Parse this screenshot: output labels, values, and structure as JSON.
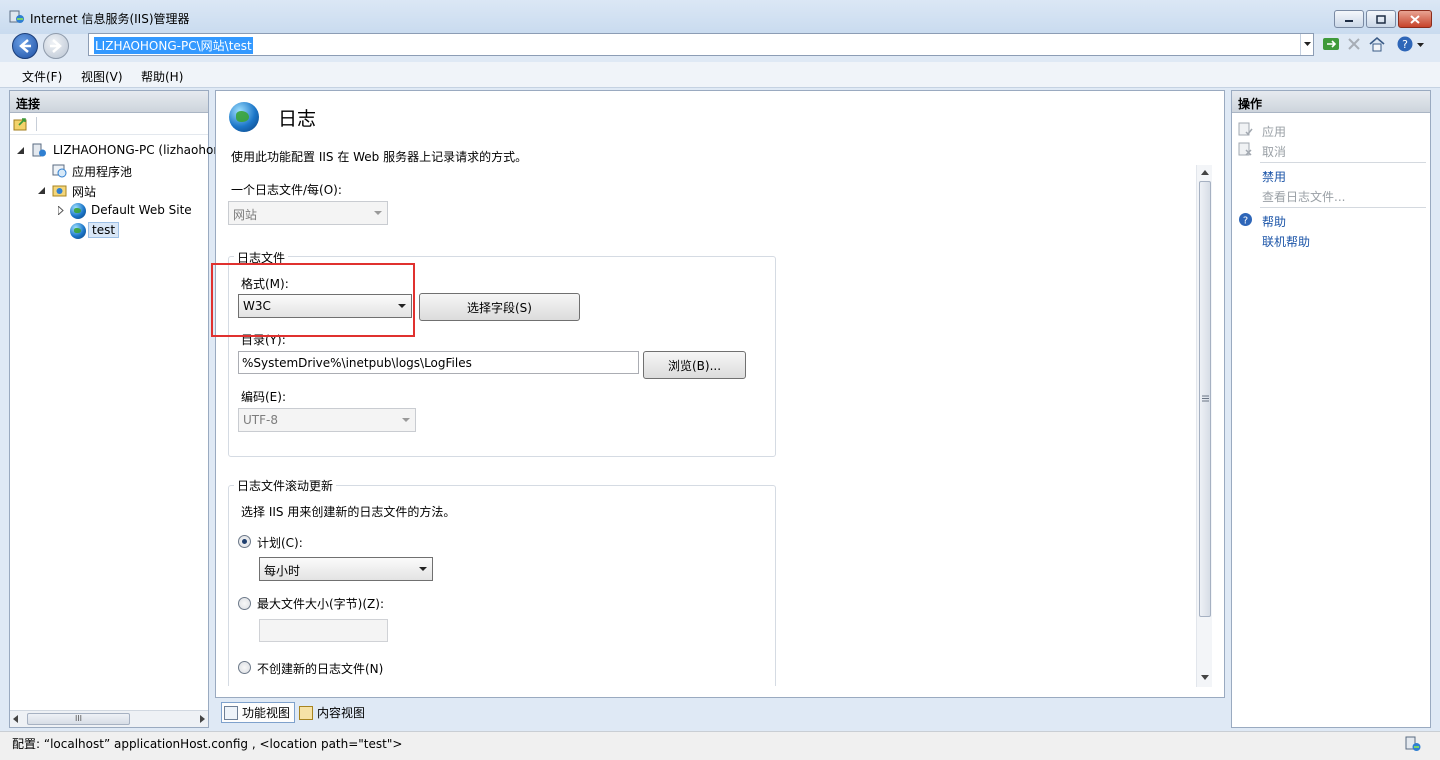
{
  "window": {
    "title": "Internet 信息服务(IIS)管理器"
  },
  "address": {
    "path": "LIZHAOHONG-PC\\网站\\test"
  },
  "menu": {
    "items": [
      "文件(F)",
      "视图(V)",
      "帮助(H)"
    ]
  },
  "connections": {
    "header": "连接",
    "tree": [
      {
        "label": "LIZHAOHONG-PC (lizhaohong",
        "level": 0
      },
      {
        "label": "应用程序池",
        "level": 1
      },
      {
        "label": "网站",
        "level": 1
      },
      {
        "label": "Default Web Site",
        "level": 2
      },
      {
        "label": "test",
        "level": 2,
        "selected": true
      }
    ],
    "scroll_thumb_label": "III"
  },
  "main": {
    "title": "日志",
    "description": "使用此功能配置 IIS 在 Web 服务器上记录请求的方式。",
    "one_log_per_label": "一个日志文件/每(O):",
    "one_log_per_value": "网站",
    "log_file_group": {
      "title": "日志文件",
      "format_label": "格式(M):",
      "format_value": "W3C",
      "select_fields_button": "选择字段(S)",
      "directory_label": "目录(Y):",
      "directory_value": "%SystemDrive%\\inetpub\\logs\\LogFiles",
      "browse_button": "浏览(B)...",
      "encoding_label": "编码(E):",
      "encoding_value": "UTF-8"
    },
    "rollover_group": {
      "title": "日志文件滚动更新",
      "description": "选择 IIS 用来创建新的日志文件的方法。",
      "schedule_label": "计划(C):",
      "schedule_value": "每小时",
      "max_size_label": "最大文件大小(字节)(Z):",
      "max_size_value": "",
      "no_new_label": "不创建新的日志文件(N)"
    }
  },
  "view_tabs": {
    "features": "功能视图",
    "content": "内容视图"
  },
  "actions": {
    "header": "操作",
    "apply": "应用",
    "cancel": "取消",
    "disable": "禁用",
    "view_logs": "查看日志文件...",
    "help": "帮助",
    "online_help": "联机帮助"
  },
  "status": {
    "text": "配置: “localhost”  applicationHost.config , <location path=\"test\">"
  },
  "colors": {
    "highlight_box": "#e0312f",
    "link": "#1c55a8",
    "selection": "#3399ff"
  }
}
